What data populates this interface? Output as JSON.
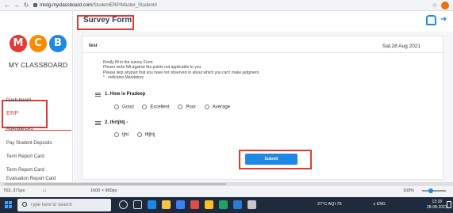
{
  "browser": {
    "url_host": "mistg.myclassboard.com",
    "url_path": "/StudentERP/Master_Student#",
    "back_icon": "arrow-left-icon",
    "forward_icon": "arrow-right-icon",
    "reload_icon": "reload-icon"
  },
  "sidebar": {
    "logo_letters": [
      "M",
      "C",
      "B"
    ],
    "logo_colors": [
      "#e53935",
      "#fb8c00",
      "#1e88e5"
    ],
    "logo_text": "MY CLASSBOARD",
    "items": [
      {
        "label": "Dash board"
      },
      {
        "label": "ERP",
        "color": "#e53935"
      },
      {
        "label": "Attendance1"
      },
      {
        "label": "Pay Student Deposits"
      },
      {
        "label": "Term Report Card"
      },
      {
        "label": "Term Report Card"
      },
      {
        "label": "Evaluation Report Card"
      }
    ]
  },
  "header": {
    "title": "Survey Form"
  },
  "form": {
    "author": "tesr",
    "date": "Sat,28 Aug 2021",
    "instructions": [
      "Kindly fill in the survey Form",
      "Please write NA against the points not applicable to you.",
      "Please skip anypart that you have not observed or about which you can't make judgment.",
      "* - indicates Mandatory"
    ],
    "questions": [
      {
        "label": "1. How is Pradeep",
        "options": [
          "Good",
          "Excellent",
          "Poor",
          "Average"
        ]
      },
      {
        "label": "2. thrtjhtj -",
        "options": [
          "tjht",
          "tftjhtj"
        ]
      }
    ],
    "submit_label": "Submit"
  },
  "devtools": {
    "coords": "763, 371px",
    "viewport": "1600 × 900px",
    "zoom": "100%"
  },
  "taskbar": {
    "search_placeholder": "Type here to search",
    "weather": "27°C  AQI 75",
    "tray": "∧  ENG",
    "time": "13:18",
    "date": "28-08-2021"
  }
}
